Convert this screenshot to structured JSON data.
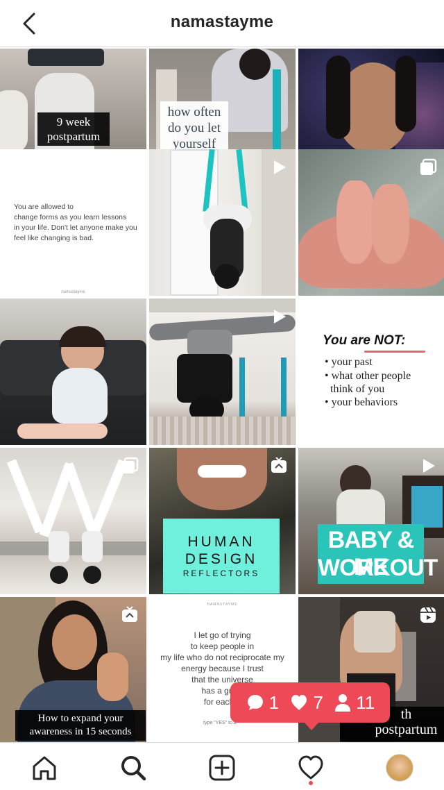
{
  "header": {
    "title": "namastayme"
  },
  "posts": {
    "p1": {
      "caption": "9 week\npostpartum"
    },
    "p2": {
      "caption": "how often\ndo you let\nyourself"
    },
    "p4": {
      "quote": "You are allowed to\nchange forms as you learn lessons\nin your life. Don't let anyone make you\nfeel like changing is bad.",
      "footer": "namastayme"
    },
    "p9": {
      "heading": "You are NOT:",
      "bullets": [
        "• your past",
        "• what other people\n  think of you",
        "• your behaviors"
      ]
    },
    "p11": {
      "line1": "HUMAN",
      "line2": "DESIGN",
      "line3": "REFLECTORS"
    },
    "p12": {
      "line1": "BABY & ME",
      "line2": "WORKOUT"
    },
    "p13": {
      "caption": "How to expand your\nawareness in 15 seconds"
    },
    "p14": {
      "header": "NAMASTAYME",
      "quote": "I let go of trying\nto keep people in\nmy life who do not reciprocate my\nenergy because I trust\nthat the universe\nhas a great\nfor each o",
      "footer": "type \"YES\" to a"
    },
    "p15": {
      "caption": "th\npostpartum"
    }
  },
  "notifications": {
    "comments": "1",
    "likes": "7",
    "follows": "11"
  },
  "colors": {
    "accent": "#ed4956",
    "teal": "#22d3c5"
  },
  "icons": {
    "back": "chevron-left-icon",
    "home": "home-icon",
    "search": "search-icon",
    "add": "add-post-icon",
    "activity": "heart-icon",
    "profile": "avatar"
  }
}
